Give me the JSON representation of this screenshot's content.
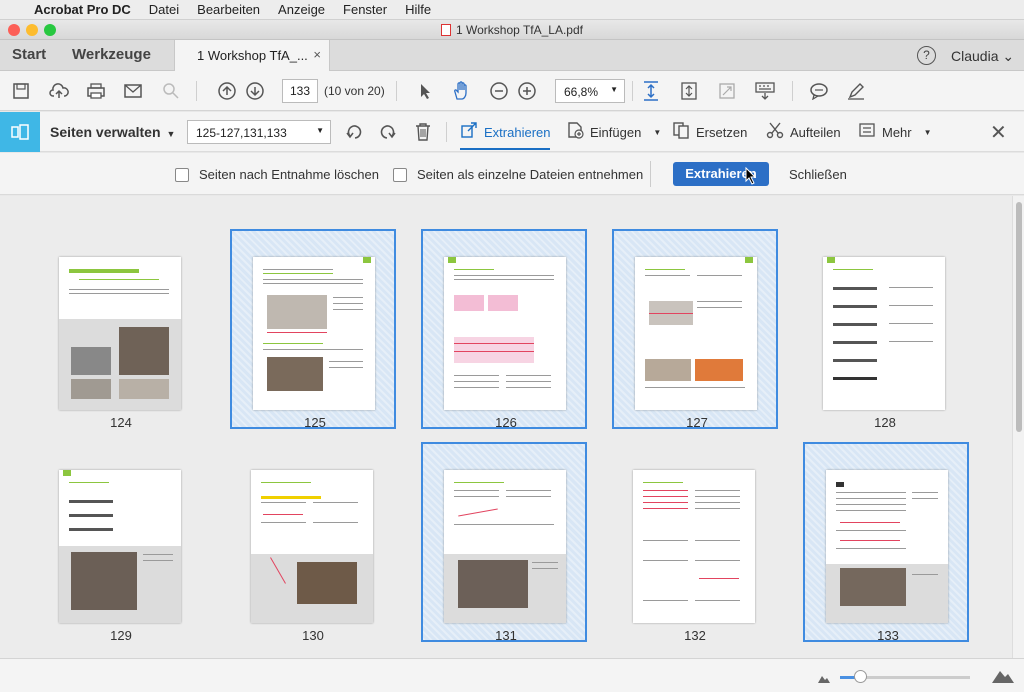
{
  "mac_menu": {
    "app": "Acrobat Pro DC",
    "items": [
      "Datei",
      "Bearbeiten",
      "Anzeige",
      "Fenster",
      "Hilfe"
    ]
  },
  "window_title": "1 Workshop TfA_LA.pdf",
  "tabs": {
    "start": "Start",
    "tools": "Werkzeuge",
    "doc": "1 Workshop TfA_...",
    "close": "×"
  },
  "user": {
    "help": "?",
    "name": "Claudia"
  },
  "toolbar": {
    "page": "133",
    "page_count": "(10 von 20)",
    "zoom": "66,8%"
  },
  "organize": {
    "title": "Seiten verwalten",
    "range": "125-127,131,133",
    "extract": "Extrahieren",
    "insert": "Einfügen",
    "replace": "Ersetzen",
    "split": "Aufteilen",
    "more": "Mehr"
  },
  "options": {
    "delete_after": "Seiten nach Entnahme löschen",
    "separate_files": "Seiten als einzelne Dateien entnehmen",
    "extract_button": "Extrahieren",
    "close_button": "Schließen"
  },
  "pages": [
    {
      "num": "124",
      "selected": false
    },
    {
      "num": "125",
      "selected": true
    },
    {
      "num": "126",
      "selected": true
    },
    {
      "num": "127",
      "selected": true
    },
    {
      "num": "128",
      "selected": false
    },
    {
      "num": "129",
      "selected": false
    },
    {
      "num": "130",
      "selected": false
    },
    {
      "num": "131",
      "selected": true
    },
    {
      "num": "132",
      "selected": false
    },
    {
      "num": "133",
      "selected": true
    }
  ],
  "colors": {
    "accent": "#2c6fc6",
    "selection": "#3f8be0",
    "tool_icon": "#3fb7e6",
    "green": "#8cc63f"
  },
  "zoom_slider": 0.15
}
